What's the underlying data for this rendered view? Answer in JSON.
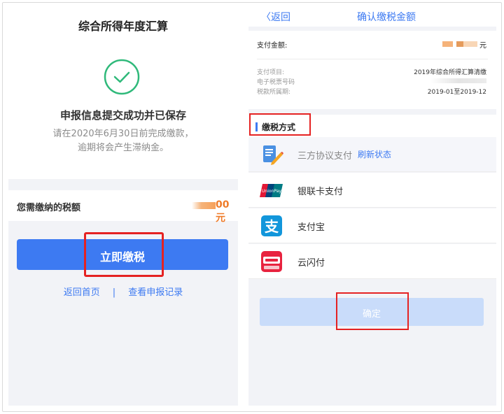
{
  "left": {
    "title": "综合所得年度汇算",
    "headline": "申报信息提交成功并已保存",
    "sub_line1": "请在2020年6月30日前完成缴款，",
    "sub_line2": "逾期将会产生滞纳金。",
    "amount_label": "您需缴纳的税额",
    "amount_value": "00元",
    "pay_button": "立即缴税",
    "link_home": "返回首页",
    "link_sep": "|",
    "link_records": "查看申报记录"
  },
  "right": {
    "back_label": "〈返回",
    "nav_title": "确认缴税金额",
    "pay_amount_label": "支付金额:",
    "pay_amount_unit": "元",
    "rows": [
      {
        "label": "支付项目:",
        "value": "2019年综合所得汇算清缴"
      },
      {
        "label": "电子税票号码",
        "value": ""
      },
      {
        "label": "税款所属期:",
        "value": "2019-01至2019-12"
      }
    ],
    "method_title": "缴税方式",
    "methods": [
      {
        "label": "三方协议支付",
        "extra": "刷新状态",
        "icon": "agreement-icon"
      },
      {
        "label": "银联卡支付",
        "icon": "unionpay-icon"
      },
      {
        "label": "支付宝",
        "icon": "alipay-icon"
      },
      {
        "label": "云闪付",
        "icon": "quickpass-icon"
      }
    ],
    "confirm_label": "确定"
  },
  "colors": {
    "accent": "#3d7af2",
    "highlight": "#e52222",
    "amount": "#ef7b28",
    "success": "#2fb97a"
  }
}
